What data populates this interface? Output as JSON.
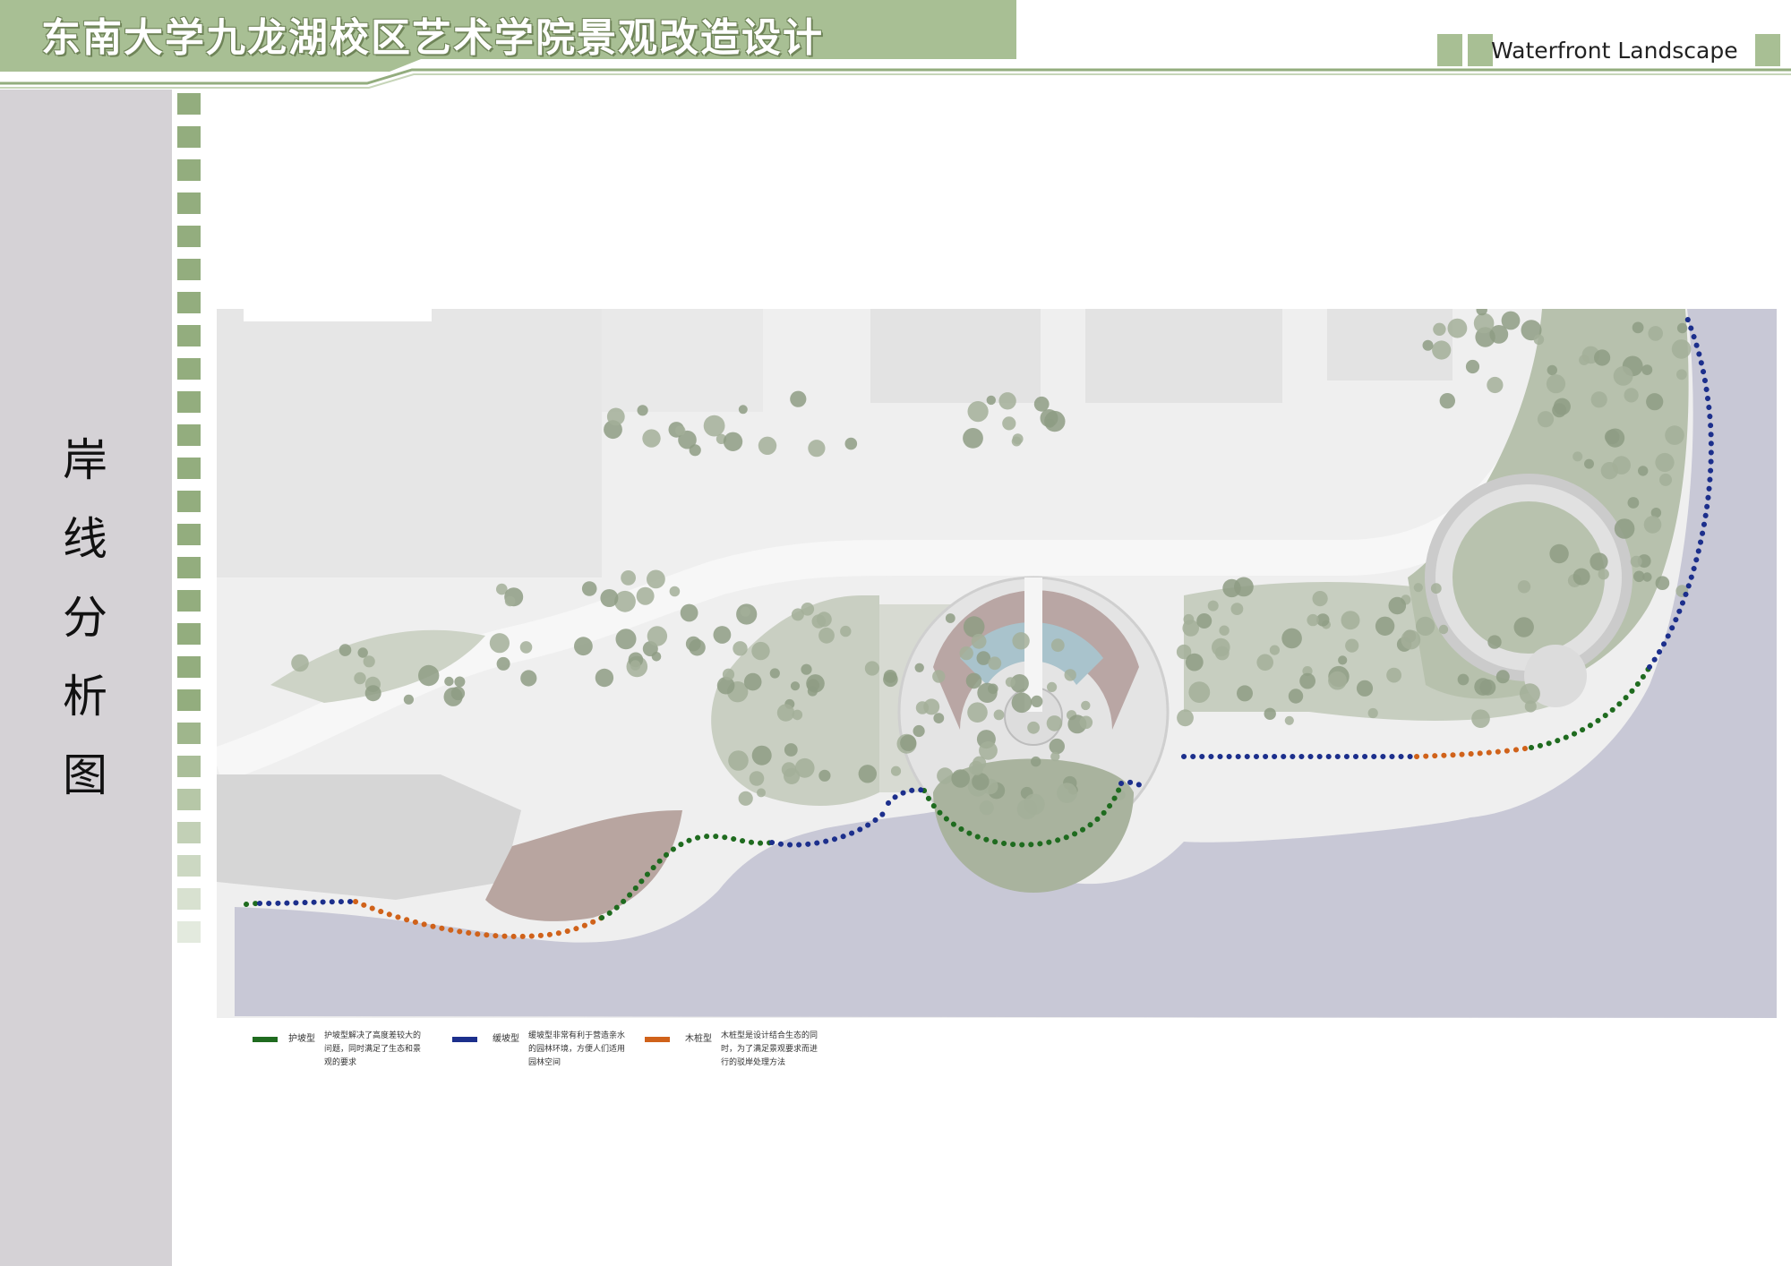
{
  "header": {
    "title": "东南大学九龙湖校区艺术学院景观改造设计",
    "subtitle": "Waterfront Landscape"
  },
  "side": {
    "title_chars": [
      "岸",
      "线",
      "分",
      "析",
      "图"
    ]
  },
  "legend": {
    "items": [
      {
        "label": "护坡型",
        "description": "护坡型解决了高度差较大的问题，同时满足了生态和景观的要求",
        "color": "#1f6b1f"
      },
      {
        "label": "缓坡型",
        "description": "缓坡型非常有利于营造亲水的园林环境，方便人们适用园林空间",
        "color": "#1c2f8c"
      },
      {
        "label": "木桩型",
        "description": "木桩型是设计结合生态的同时，为了满足景观要求而进行的驳岸处理方法",
        "color": "#d0621a"
      }
    ]
  },
  "colors": {
    "title_band": "#a8bf94",
    "accent_green": "#93ad7e",
    "side_panel": "#d5d2d6",
    "water": "#c8c8d6",
    "green_slope": "#1f6b1f",
    "gentle_slope": "#1c2f8c",
    "timber_pile": "#d0621a"
  }
}
